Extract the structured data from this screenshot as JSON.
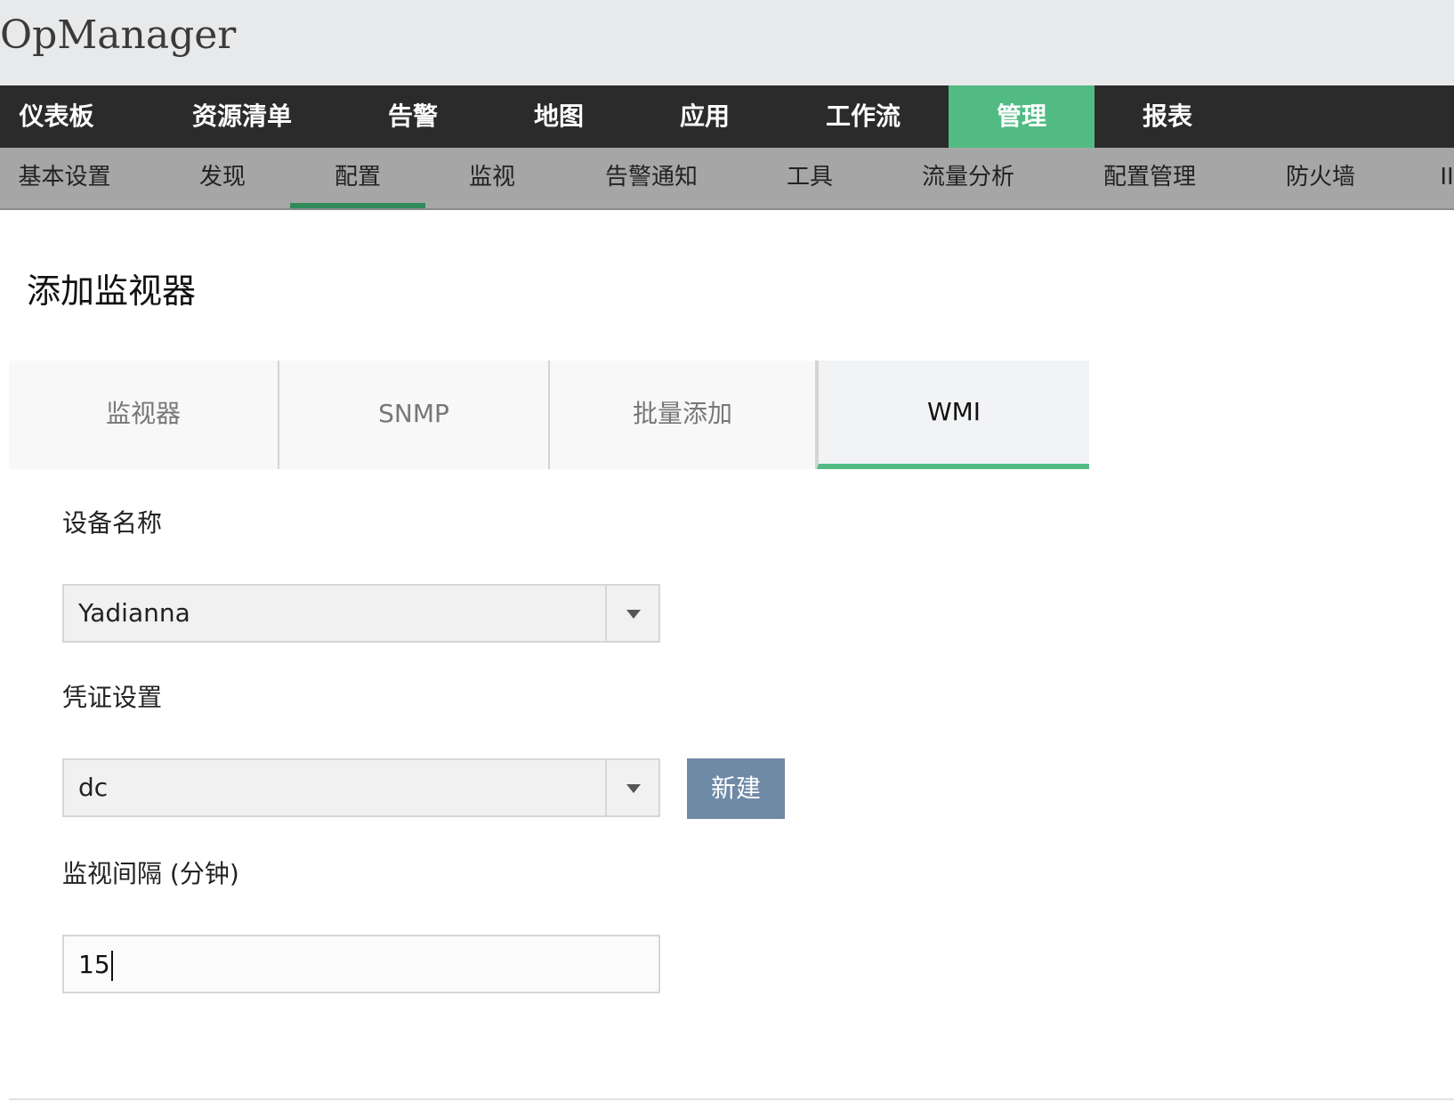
{
  "app": {
    "title": "OpManager"
  },
  "main_nav": {
    "items": [
      {
        "label": "仪表板"
      },
      {
        "label": "资源清单"
      },
      {
        "label": "告警"
      },
      {
        "label": "地图"
      },
      {
        "label": "应用"
      },
      {
        "label": "工作流"
      },
      {
        "label": "管理",
        "active": true
      },
      {
        "label": "报表"
      }
    ]
  },
  "sub_nav": {
    "items": [
      {
        "label": "基本设置"
      },
      {
        "label": "发现"
      },
      {
        "label": "配置",
        "active": true
      },
      {
        "label": "监视"
      },
      {
        "label": "告警通知"
      },
      {
        "label": "工具"
      },
      {
        "label": "流量分析"
      },
      {
        "label": "配置管理"
      },
      {
        "label": "防火墙"
      },
      {
        "label": "II"
      }
    ]
  },
  "page": {
    "title": "添加监视器"
  },
  "tabs": [
    {
      "label": "监视器"
    },
    {
      "label": "SNMP"
    },
    {
      "label": "批量添加"
    },
    {
      "label": "WMI",
      "active": true
    }
  ],
  "form": {
    "device_name": {
      "label": "设备名称",
      "value": "Yadianna"
    },
    "credential": {
      "label": "凭证设置",
      "value": "dc",
      "new_button": "新建"
    },
    "interval": {
      "label": "监视间隔 (分钟)",
      "value": "15"
    }
  },
  "colors": {
    "accent_green": "#52bb84",
    "nav_dark": "#2b2b2b",
    "subnav_gray": "#a6a6a6",
    "button_blue": "#6f8aa5"
  }
}
